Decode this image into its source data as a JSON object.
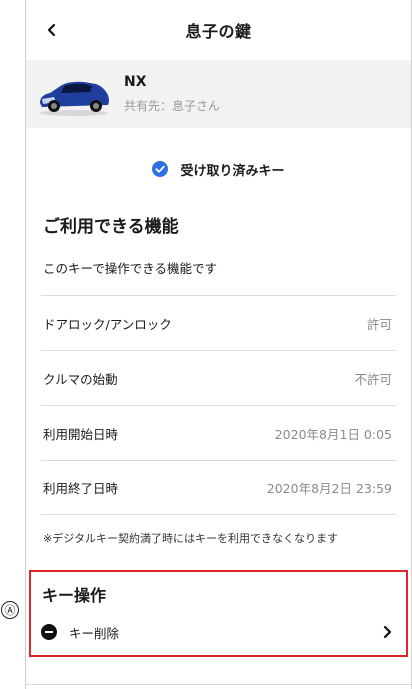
{
  "header": {
    "title": "息子の鍵",
    "back_icon": "chevron-left-icon"
  },
  "car": {
    "name": "NX",
    "shared_with": "共有先：息子さん"
  },
  "received": {
    "label": "受け取り済みキー",
    "icon": "check-circle-icon",
    "icon_color": "#2f6fe4"
  },
  "features": {
    "title": "ご利用できる機能",
    "description": "このキーで操作できる機能です",
    "rows": [
      {
        "label": "ドアロック/アンロック",
        "value": "許可"
      },
      {
        "label": "クルマの始動",
        "value": "不許可"
      },
      {
        "label": "利用開始日時",
        "value": "2020年8月1日 0:05"
      },
      {
        "label": "利用終了日時",
        "value": "2020年8月2日 23:59"
      }
    ],
    "note": "※デジタルキー契約満了時にはキーを利用できなくなります"
  },
  "key_operation": {
    "callout": "Ⓐ",
    "title": "キー操作",
    "delete_label": "キー削除",
    "highlight_color": "#e0242a"
  }
}
